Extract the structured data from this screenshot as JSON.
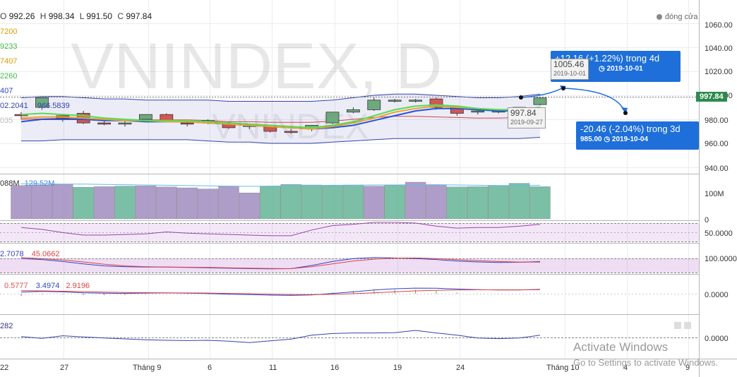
{
  "ohlc": {
    "o_label": "O",
    "o": "992.26",
    "h_label": "H",
    "h": "998.34",
    "l_label": "L",
    "l": "991.50",
    "c_label": "C",
    "c": "997.84"
  },
  "ma_values": [
    "7200",
    "9233",
    "7407",
    "2260",
    "407"
  ],
  "bb_values": {
    "v1": "02.2041",
    "v2": "966.5839",
    "v3": "035"
  },
  "market_status": "đóng cửa",
  "watermark": {
    "symbol": "VNINDEX, D",
    "sub": "VNINDEX"
  },
  "last_price": "997.84",
  "projection_up": {
    "text": "+12.16 (+1.22%) trong 4d",
    "price": "1005.46",
    "date": "2019-10-01"
  },
  "projection_down": {
    "text": "-20.46 (-2.04%) trong 3d",
    "price": "985.00",
    "date": "2019-10-04"
  },
  "anchor_point": {
    "price": "997.84",
    "date": "2019-09-27"
  },
  "volume_labels": {
    "v1": "088M",
    "v2": "129.52M"
  },
  "osc1_labels": {
    "a": "2.7078",
    "b": "45.0662"
  },
  "macd_labels": {
    "a": "0.5777",
    "b": "3.4974",
    "c": "2.9196"
  },
  "osc3_label": "282",
  "activate": {
    "title": "Activate Windows",
    "sub": "Go to Settings to activate Windows."
  },
  "price_axis": [
    "1060.00",
    "1040.00",
    "1020.00",
    "1000.00",
    "980.00",
    "960.00",
    "940.00"
  ],
  "volume_axis": [
    "100M",
    "0"
  ],
  "osc_axis": [
    "50.0000"
  ],
  "osc1_axis": [
    "100.0000"
  ],
  "macd_axis": [
    "0.0000"
  ],
  "osc3_axis": [
    "0.0000"
  ],
  "time_axis": [
    "22",
    "27",
    "Tháng 9",
    "6",
    "11",
    "16",
    "19",
    "24",
    "Tháng 10",
    "4",
    "9"
  ],
  "chart_data": {
    "type": "candlestick",
    "candles": [
      {
        "o": 984,
        "h": 986,
        "l": 980,
        "c": 983,
        "up": false
      },
      {
        "o": 990,
        "h": 998,
        "l": 988,
        "c": 998,
        "up": true
      },
      {
        "o": 981,
        "h": 984,
        "l": 978,
        "c": 983,
        "up": false
      },
      {
        "o": 985,
        "h": 987,
        "l": 976,
        "c": 977,
        "up": false
      },
      {
        "o": 977,
        "h": 979,
        "l": 975,
        "c": 976,
        "up": false
      },
      {
        "o": 976,
        "h": 979,
        "l": 974,
        "c": 977,
        "up": true
      },
      {
        "o": 980,
        "h": 984,
        "l": 979,
        "c": 984,
        "up": true
      },
      {
        "o": 984,
        "h": 985,
        "l": 978,
        "c": 979,
        "up": false
      },
      {
        "o": 977,
        "h": 978,
        "l": 974,
        "c": 976,
        "up": false
      },
      {
        "o": 979,
        "h": 980,
        "l": 976,
        "c": 977,
        "up": false
      },
      {
        "o": 977,
        "h": 978,
        "l": 972,
        "c": 973,
        "up": false
      },
      {
        "o": 974,
        "h": 976,
        "l": 972,
        "c": 975,
        "up": true
      },
      {
        "o": 974,
        "h": 975,
        "l": 969,
        "c": 970,
        "up": false
      },
      {
        "o": 970,
        "h": 972,
        "l": 968,
        "c": 969,
        "up": false
      },
      {
        "o": 972,
        "h": 975,
        "l": 970,
        "c": 975,
        "up": true
      },
      {
        "o": 977,
        "h": 986,
        "l": 976,
        "c": 986,
        "up": true
      },
      {
        "o": 986,
        "h": 990,
        "l": 985,
        "c": 988,
        "up": true
      },
      {
        "o": 988,
        "h": 998,
        "l": 987,
        "c": 996,
        "up": true
      },
      {
        "o": 996,
        "h": 997,
        "l": 994,
        "c": 995,
        "up": true
      },
      {
        "o": 995,
        "h": 997,
        "l": 994,
        "c": 996,
        "up": true
      },
      {
        "o": 997,
        "h": 998,
        "l": 988,
        "c": 990,
        "up": false
      },
      {
        "o": 990,
        "h": 991,
        "l": 983,
        "c": 985,
        "up": false
      },
      {
        "o": 987,
        "h": 989,
        "l": 984,
        "c": 986,
        "up": true
      },
      {
        "o": 986,
        "h": 988,
        "l": 985,
        "c": 987,
        "up": true
      },
      {
        "o": 988,
        "h": 990,
        "l": 986,
        "c": 990,
        "up": true
      },
      {
        "o": 992.26,
        "h": 998.34,
        "l": 991.5,
        "c": 997.84,
        "up": true
      }
    ],
    "ma_fast": [
      984,
      985,
      984,
      983,
      981,
      980,
      979,
      979,
      979,
      978,
      977,
      976,
      975,
      974,
      973,
      975,
      978,
      983,
      988,
      991,
      992,
      991,
      989,
      988,
      988,
      990
    ],
    "ma_slow": [
      978,
      980,
      980,
      980,
      979,
      979,
      978,
      978,
      978,
      977,
      976,
      975,
      974,
      973,
      972,
      973,
      975,
      979,
      983,
      987,
      989,
      989,
      988,
      987,
      987,
      988
    ],
    "ma_mid": [
      981,
      982,
      982,
      981,
      980,
      979,
      979,
      978,
      978,
      977,
      976,
      975,
      974,
      973,
      972,
      974,
      977,
      981,
      986,
      989,
      991,
      990,
      989,
      988,
      988,
      989
    ],
    "bb_upper": [
      998,
      999,
      999,
      998,
      997,
      997,
      996,
      996,
      996,
      996,
      995,
      995,
      995,
      995,
      995,
      996,
      998,
      1000,
      1001,
      1001,
      1000,
      999,
      998,
      998,
      999,
      1001
    ],
    "bb_lower": [
      962,
      962,
      963,
      963,
      963,
      963,
      963,
      963,
      963,
      962,
      961,
      961,
      960,
      960,
      960,
      961,
      962,
      963,
      964,
      964,
      964,
      964,
      964,
      964,
      964,
      965
    ],
    "volume": [
      {
        "v": 118,
        "up": false
      },
      {
        "v": 120,
        "up": false
      },
      {
        "v": 122,
        "up": false
      },
      {
        "v": 112,
        "up": true
      },
      {
        "v": 114,
        "up": false
      },
      {
        "v": 116,
        "up": true
      },
      {
        "v": 117,
        "up": false
      },
      {
        "v": 113,
        "up": false
      },
      {
        "v": 110,
        "up": false
      },
      {
        "v": 106,
        "up": false
      },
      {
        "v": 116,
        "up": false
      },
      {
        "v": 92,
        "up": false
      },
      {
        "v": 116,
        "up": true
      },
      {
        "v": 122,
        "up": true
      },
      {
        "v": 120,
        "up": true
      },
      {
        "v": 118,
        "up": true
      },
      {
        "v": 120,
        "up": true
      },
      {
        "v": 116,
        "up": false
      },
      {
        "v": 118,
        "up": true
      },
      {
        "v": 130,
        "up": false
      },
      {
        "v": 121,
        "up": false
      },
      {
        "v": 113,
        "up": true
      },
      {
        "v": 114,
        "up": true
      },
      {
        "v": 118,
        "up": true
      },
      {
        "v": 126,
        "up": true
      },
      {
        "v": 114,
        "up": true
      }
    ],
    "volume_ma": [
      124,
      124,
      123,
      123,
      122,
      121,
      120,
      119,
      118,
      117,
      116,
      115,
      116,
      117,
      118,
      119,
      119,
      120,
      120,
      121,
      121,
      120,
      119,
      118,
      118,
      119
    ],
    "rsi": [
      52,
      49,
      44,
      40,
      40,
      41,
      42,
      45,
      43,
      42,
      41,
      40,
      39,
      39,
      48,
      55,
      57,
      60,
      60,
      59,
      54,
      51,
      52,
      52,
      54,
      57
    ],
    "stoch_k": [
      85,
      80,
      70,
      58,
      48,
      44,
      42,
      42,
      40,
      38,
      36,
      34,
      33,
      34,
      50,
      70,
      85,
      90,
      88,
      85,
      80,
      72,
      68,
      65,
      66,
      70
    ],
    "stoch_d": [
      90,
      85,
      78,
      68,
      56,
      48,
      44,
      42,
      41,
      40,
      38,
      36,
      35,
      34,
      44,
      58,
      72,
      82,
      87,
      88,
      85,
      79,
      74,
      70,
      67,
      67
    ],
    "macd": [
      1,
      1.5,
      1.2,
      0.6,
      0.3,
      0.2,
      0.4,
      0.5,
      0.3,
      0.1,
      -0.3,
      -0.6,
      -0.9,
      -1.1,
      -0.8,
      0.2,
      1.2,
      2.4,
      3.2,
      3.6,
      3.5,
      3.0,
      2.6,
      2.4,
      2.4,
      2.8
    ],
    "macd_signal": [
      2,
      1.8,
      1.6,
      1.3,
      1.0,
      0.8,
      0.7,
      0.6,
      0.5,
      0.4,
      0.2,
      0,
      -0.3,
      -0.5,
      -0.6,
      -0.4,
      0,
      0.6,
      1.2,
      1.8,
      2.2,
      2.4,
      2.5,
      2.5,
      2.5,
      2.6
    ],
    "osc3": [
      0.3,
      -0.3,
      0.6,
      0.2,
      -0.2,
      -0.5,
      -0.8,
      -1.0,
      -1.1,
      -1.0,
      -1.3,
      -1.8,
      -1.2,
      -0.6,
      0.8,
      1.4,
      1.6,
      1.6,
      1.7,
      2.5,
      1.6,
      0.8,
      -0.2,
      -0.4,
      -0.2,
      0.8
    ]
  }
}
